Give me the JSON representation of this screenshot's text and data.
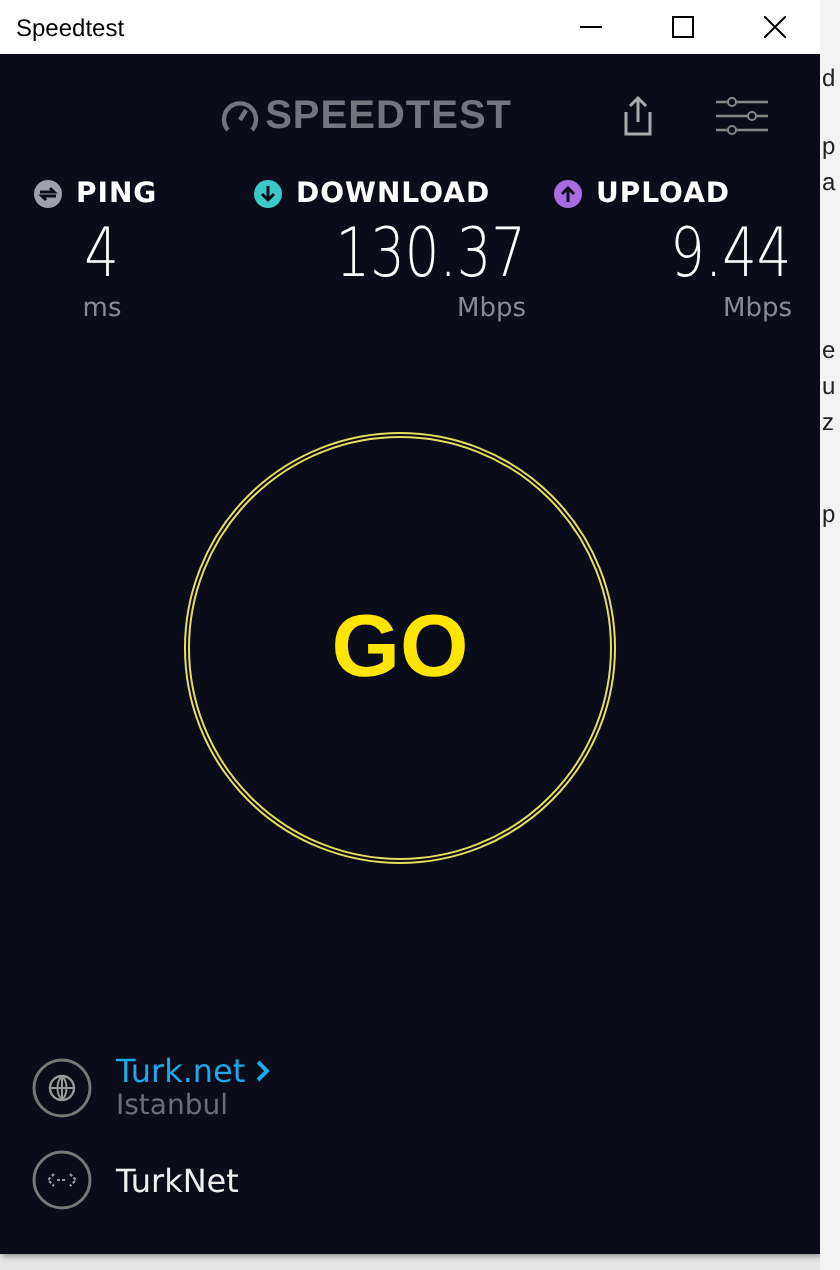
{
  "window": {
    "title": "Speedtest"
  },
  "header": {
    "logo": "SPEEDTEST"
  },
  "metrics": [
    {
      "kind": "ping",
      "label": "PING",
      "value": "4",
      "unit": "ms",
      "color": "#a0a0aa"
    },
    {
      "kind": "download",
      "label": "DOWNLOAD",
      "value": "130.37",
      "unit": "Mbps",
      "color": "#3cc8c8"
    },
    {
      "kind": "upload",
      "label": "UPLOAD",
      "value": "9.44",
      "unit": "Mbps",
      "color": "#a86ce0"
    }
  ],
  "go_button": {
    "label": "GO"
  },
  "server": {
    "name": "Turk.net",
    "location": "Istanbul"
  },
  "provider": {
    "name": "TurkNet"
  },
  "background_window": {
    "lines": [
      "d",
      "p",
      "a",
      "e",
      "u",
      "z",
      "p"
    ]
  }
}
